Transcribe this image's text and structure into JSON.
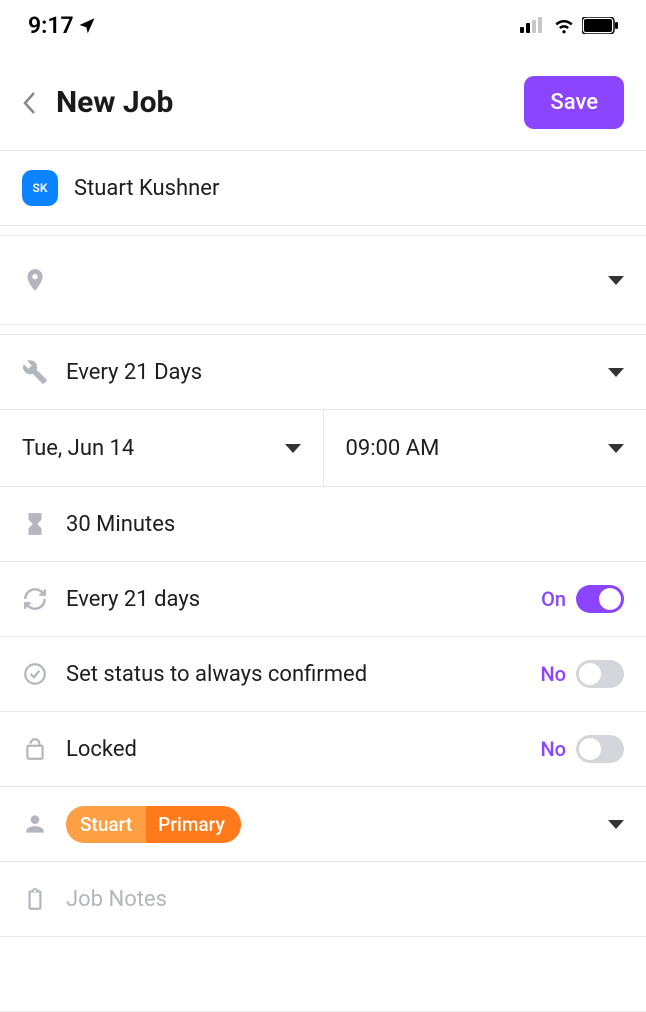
{
  "status_bar": {
    "time": "9:17"
  },
  "header": {
    "title": "New Job",
    "save_label": "Save"
  },
  "customer": {
    "initials": "SK",
    "name": "Stuart Kushner"
  },
  "location": {
    "value": ""
  },
  "frequency": {
    "label": "Every 21 Days"
  },
  "date": {
    "label": "Tue, Jun 14"
  },
  "time": {
    "label": "09:00 AM"
  },
  "duration": {
    "label": "30 Minutes"
  },
  "recurrence": {
    "label": "Every 21 days",
    "state_label": "On",
    "on": true
  },
  "status_confirmed": {
    "label": "Set status to always confirmed",
    "state_label": "No",
    "on": false
  },
  "locked": {
    "label": "Locked",
    "state_label": "No",
    "on": false
  },
  "assigned": {
    "person": "Stuart",
    "role": "Primary"
  },
  "notes": {
    "placeholder": "Job Notes"
  }
}
